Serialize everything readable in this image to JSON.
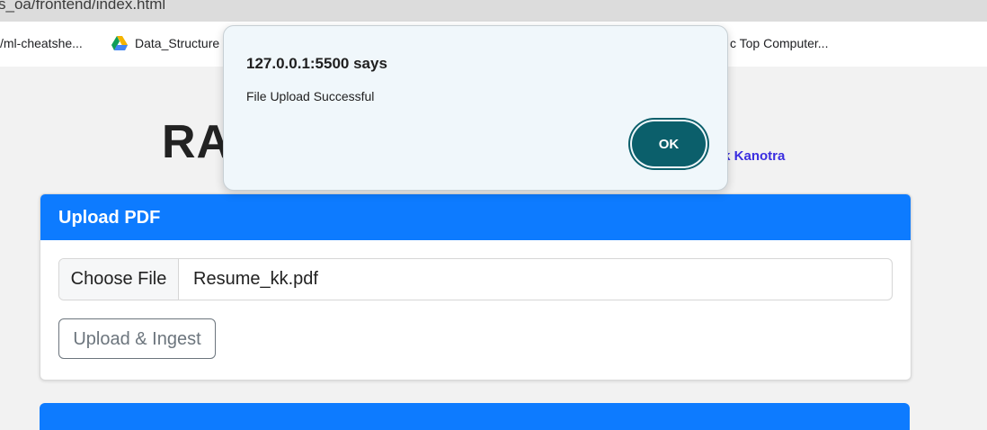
{
  "browser": {
    "address": "s_oa/frontend/index.html",
    "bookmarks": [
      "/ml-cheatshe...",
      "Data_Structure",
      "c Top Computer..."
    ]
  },
  "page": {
    "title": "RA(",
    "author_partial": "ik Kanotra"
  },
  "upload_card": {
    "header": "Upload PDF",
    "choose_label": "Choose File",
    "file_name": "Resume_kk.pdf",
    "upload_label": "Upload & Ingest"
  },
  "dialog": {
    "title": "127.0.0.1:5500 says",
    "message": "File Upload Successful",
    "ok_label": "OK"
  },
  "colors": {
    "primary": "#0d7bff",
    "dialog_button": "#0b5f6b",
    "link": "#3b2ee0"
  }
}
